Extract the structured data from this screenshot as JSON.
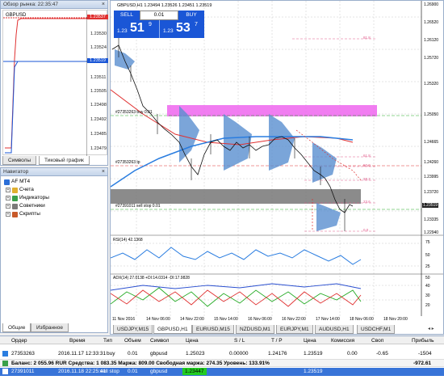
{
  "market_watch": {
    "title": "Обзор рынка: 22:35:47",
    "symbol": "GBPUSD",
    "prices": [
      "1.23537",
      "1.23530",
      "1.23524",
      "1.23519",
      "1.23511",
      "1.23505",
      "1.23498",
      "1.23492",
      "1.23485",
      "1.23479"
    ],
    "highlight_top": "1.23537",
    "highlight_bid": "1.23519",
    "tabs": [
      "Символы",
      "Тиковый график"
    ]
  },
  "navigator": {
    "title": "Навигатор",
    "items": [
      {
        "label": "AF MT4",
        "icon": "terminal-icon"
      },
      {
        "label": "Счета",
        "icon": "accounts-icon"
      },
      {
        "label": "Индикаторы",
        "icon": "indicators-icon"
      },
      {
        "label": "Советники",
        "icon": "experts-icon"
      },
      {
        "label": "Скрипты",
        "icon": "scripts-icon"
      }
    ],
    "tabs": [
      "Общие",
      "Избранное"
    ]
  },
  "chart": {
    "header": "GBPUSD,H1  1.23494 1.23526 1.23451 1.23519",
    "sell_label": "SELL",
    "buy_label": "BUY",
    "lot_value": "0.01",
    "sell_price_small": "1.23",
    "sell_price_big": "51",
    "sell_price_sup": "9",
    "buy_price_small": "1.23",
    "buy_price_big": "53",
    "buy_price_sup": "7",
    "price_axis": [
      "1.26900",
      "1.26520",
      "1.26120",
      "1.25720",
      "1.25320",
      "1.25050",
      "1.24665",
      "1.24260",
      "1.23995",
      "1.23720",
      "1.23519",
      "1.23335",
      "1.22940"
    ],
    "price_axis_current": "1.23519",
    "order_label_1": "#27353263 buy 0.01",
    "order_label_2": "#27353263 tp",
    "order_label_3": "#27391011 sell stop 0.01",
    "level_tags": [
      "81.8",
      "61.8",
      "50.0",
      "38.2",
      "23.6",
      "0.0"
    ],
    "rsi_label": "RSI(14) 42.1368",
    "rsi_axis": [
      "75",
      "50",
      "25"
    ],
    "adx_label": "ADX(14) 27.0138 +DI:14.0314 -DI:17.9828",
    "adx_axis": [
      "50",
      "40",
      "30",
      "20"
    ],
    "time_axis": [
      "11 Nov 2016",
      "14 Nov 06:00",
      "14 Nov 22:00",
      "15 Nov 14:00",
      "16 Nov 06:00",
      "16 Nov 22:00",
      "17 Nov 14:00",
      "18 Nov 06:00",
      "18 Nov 20:00"
    ],
    "tabs": [
      "USDJPY,M15",
      "GBPUSD,H1",
      "EURUSD,M15",
      "NZDUSD,M1",
      "EURJPY,M1",
      "AUDUSD,H1",
      "USDCHF,M1"
    ]
  },
  "terminal": {
    "headers": [
      "Ордер",
      "Время",
      "Тип",
      "Объем",
      "Символ",
      "Цена",
      "S / L",
      "T / P",
      "Цена",
      "Комиссия",
      "Своп",
      "Прибыль"
    ],
    "open_row": [
      "27353263",
      "2016.11.17 12:33:31",
      "buy",
      "0.01",
      "gbpusd",
      "1.25023",
      "0.00000",
      "1.24176",
      "1.23519",
      "0.00",
      "-0.65",
      "-1504"
    ],
    "balance_text": "Баланс: 2 055.96 RUR  Средства: 1 083.35  Маржа: 809.00  Свободная маржа: 274.35  Уровень: 133.91%",
    "balance_profit": "-972.61",
    "pending_row": [
      "27391011",
      "2016.11.18 22:25:41",
      "sell stop",
      "0.01",
      "gbpusd",
      "1.23447",
      "",
      "",
      "1.23519",
      "",
      "",
      ""
    ]
  }
}
